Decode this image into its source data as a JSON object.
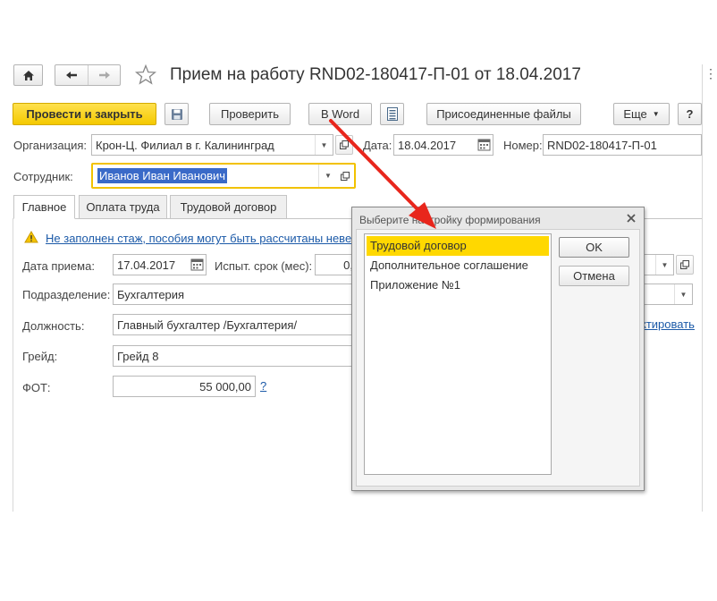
{
  "window": {
    "title": "Прием на работу RND02-180417-П-01 от 18.04.2017"
  },
  "toolbar": {
    "post_and_close": "Провести и закрыть",
    "check": "Проверить",
    "to_word": "В Word",
    "attached_files": "Присоединенные файлы",
    "more": "Еще",
    "help": "?"
  },
  "header": {
    "org_label": "Организация:",
    "org_value": "Крон-Ц. Филиал в г. Калининград",
    "date_label": "Дата:",
    "date_value": "18.04.2017",
    "number_label": "Номер:",
    "number_value": "RND02-180417-П-01",
    "employee_label": "Сотрудник:",
    "employee_value": "Иванов Иван Иванович"
  },
  "tabs": [
    {
      "label": "Главное"
    },
    {
      "label": "Оплата труда"
    },
    {
      "label": "Трудовой договор"
    }
  ],
  "main": {
    "warning": "Не заполнен стаж, пособия могут быть рассчитаны невер",
    "hire_date_label": "Дата приема:",
    "hire_date_value": "17.04.2017",
    "probation_label": "Испыт. срок (мес):",
    "probation_value": "0,",
    "department_label": "Подразделение:",
    "department_value": "Бухгалтерия",
    "position_label": "Должность:",
    "position_value": "Главный бухгалтер /Бухгалтерия/",
    "edit_link": "ктировать",
    "grade_label": "Грейд:",
    "grade_value": "Грейд 8",
    "fot_label": "ФОТ:",
    "fot_value": "55 000,00",
    "fot_help": "?"
  },
  "dialog": {
    "title": "Выберите настройку формирования",
    "items": [
      "Трудовой договор",
      "Дополнительное соглашение",
      "Приложение №1"
    ],
    "selected_index": 0,
    "ok": "OK",
    "cancel": "Отмена"
  },
  "colors": {
    "accent_yellow": "#f4c900",
    "selection_yellow": "#ffd800",
    "link_blue": "#1c5aa8",
    "arrow_red": "#e8261c",
    "employee_highlight": "#3a6ac8"
  }
}
